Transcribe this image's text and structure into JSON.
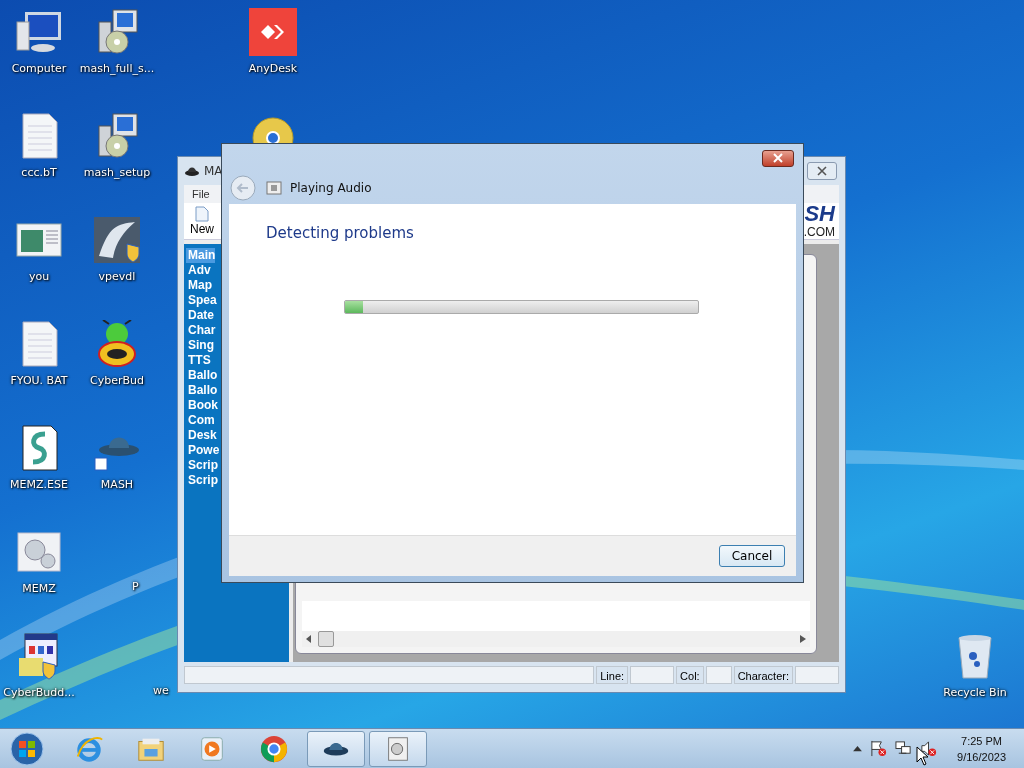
{
  "desktop_icons": [
    {
      "kind": "computer",
      "label": "Computer"
    },
    {
      "kind": "installer",
      "label": "mash_full_s..."
    },
    {
      "kind": "anydesk",
      "label": "AnyDesk"
    },
    {
      "kind": "disc"
    },
    {
      "kind": "textfile",
      "label": "ccc.bT"
    },
    {
      "kind": "installer",
      "label": "mash_setup"
    },
    {
      "kind": "window",
      "label": "you"
    },
    {
      "kind": "shieldapp",
      "label": "vpevdl"
    },
    {
      "kind": "textfile",
      "label": "FYOU. BAT"
    },
    {
      "kind": "bug",
      "label": "CyberBud"
    },
    {
      "kind": "script",
      "label": "MEMZ.ESE"
    },
    {
      "kind": "hat",
      "label": "MASH"
    },
    {
      "kind": "gears",
      "label": "MEMZ"
    },
    {
      "kind": "partial",
      "label": "P"
    },
    {
      "kind": "setupapp",
      "label": "CyberBudd..."
    },
    {
      "kind": "partial",
      "label": "we"
    },
    {
      "kind": "recycle",
      "label": "Recycle Bin"
    }
  ],
  "mash_window": {
    "title": "MA",
    "menu": [
      "File"
    ],
    "toolbar": [
      "New"
    ],
    "logo": "SH",
    "logo_suffix": ".COM",
    "sidebar_items": [
      {
        "label": "Main",
        "selected": true
      },
      {
        "label": "Adv",
        "selected": false
      },
      {
        "label": "Map",
        "selected": false
      },
      {
        "label": "Spea",
        "selected": false
      },
      {
        "label": "Date",
        "selected": false
      },
      {
        "label": "Char",
        "selected": false
      },
      {
        "label": "Sing",
        "selected": false
      },
      {
        "label": "TTS",
        "selected": false
      },
      {
        "label": "Ballo",
        "selected": false
      },
      {
        "label": "Ballo",
        "selected": false
      },
      {
        "label": "Book",
        "selected": false
      },
      {
        "label": "Com",
        "selected": false
      },
      {
        "label": "Desk",
        "selected": false
      },
      {
        "label": "Powe",
        "selected": false
      },
      {
        "label": "Scrip",
        "selected": false
      },
      {
        "label": "Scrip",
        "selected": false
      }
    ],
    "status_bar": {
      "line_label": "Line:",
      "col_label": "Col:",
      "character_label": "Character:"
    }
  },
  "dialog": {
    "title": "Playing Audio",
    "heading": "Detecting problems",
    "progress": {
      "level": 0.05
    },
    "buttons": [
      "Cancel"
    ]
  },
  "taskbar": {
    "items": [
      {
        "kind": "ie",
        "active": false
      },
      {
        "kind": "explorer",
        "active": false
      },
      {
        "kind": "media",
        "active": false
      },
      {
        "kind": "chrome",
        "active": false
      },
      {
        "kind": "mash",
        "active": true
      },
      {
        "kind": "troubleshooter",
        "active": true
      }
    ],
    "tray": [
      {
        "kind": "flag"
      },
      {
        "kind": "network"
      },
      {
        "kind": "speaker"
      }
    ],
    "clock": {
      "time": "7:25 PM",
      "date": "9/16/2023"
    }
  }
}
